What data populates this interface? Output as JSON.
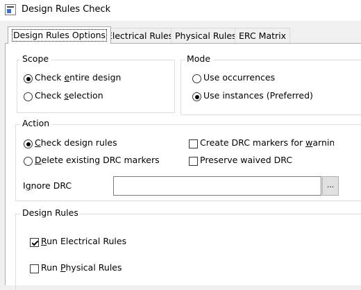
{
  "window": {
    "title": "Design Rules Check"
  },
  "tabs": [
    {
      "label": "Design Rules Options"
    },
    {
      "label": "Electrical Rules"
    },
    {
      "label": "Physical Rules"
    },
    {
      "label": "ERC Matrix"
    }
  ],
  "scope": {
    "title": "Scope",
    "check_entire": {
      "pre": "Check ",
      "u": "e",
      "post": "ntire design",
      "selected": true
    },
    "check_selection": {
      "pre": "Check ",
      "u": "s",
      "post": "election",
      "selected": false
    }
  },
  "mode": {
    "title": "Mode",
    "use_occurrences": {
      "label": "Use occurrences",
      "selected": false
    },
    "use_instances": {
      "label": "Use instances (Preferred)",
      "selected": true
    }
  },
  "action": {
    "title": "Action",
    "check_rules": {
      "pre": "",
      "u": "C",
      "post": "heck design rules",
      "selected": true
    },
    "delete_markers": {
      "pre": "",
      "u": "D",
      "post": "elete existing DRC markers",
      "selected": false
    },
    "create_markers": {
      "pre": "Create DRC markers for ",
      "u": "w",
      "post": "arnings",
      "checked": false
    },
    "preserve_waived": {
      "label": "Preserve waived DRC",
      "checked": false
    },
    "ignore_drc": {
      "pre": "I",
      "u": "g",
      "post": "nore DRC",
      "value": ""
    },
    "browse_label": "..."
  },
  "design_rules": {
    "title": "Design Rules",
    "run_electrical": {
      "pre": "",
      "u": "R",
      "post": "un Electrical Rules",
      "checked": true
    },
    "run_physical": {
      "pre": "Run ",
      "u": "P",
      "post": "hysical Rules",
      "checked": false
    }
  }
}
